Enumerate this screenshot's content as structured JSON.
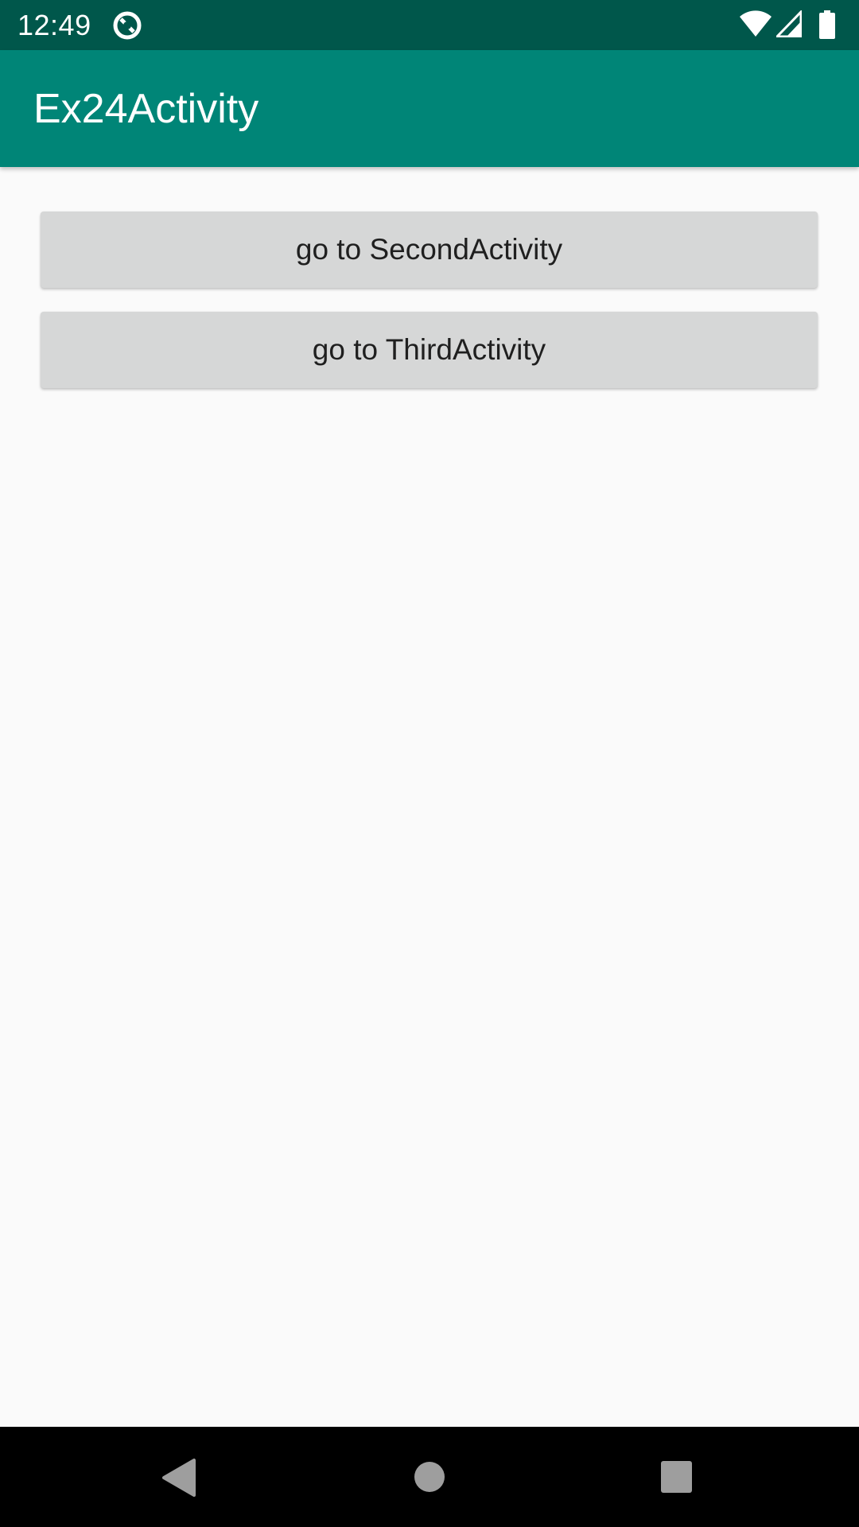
{
  "status_bar": {
    "time": "12:49",
    "notification_icon": "data-sync-icon",
    "wifi_icon": "wifi-icon",
    "signal_icon": "cell-signal-icon",
    "battery_icon": "battery-icon"
  },
  "app_bar": {
    "title": "Ex24Activity",
    "color": "#008577"
  },
  "buttons": [
    {
      "label": "go to SecondActivity"
    },
    {
      "label": "go to ThirdActivity"
    }
  ],
  "nav_bar": {
    "back_icon": "back-triangle-icon",
    "home_icon": "home-circle-icon",
    "recents_icon": "recents-square-icon"
  },
  "colors": {
    "status_bar": "#00574b",
    "app_bar": "#008577",
    "button": "#d6d7d7",
    "background": "#fafafa"
  }
}
